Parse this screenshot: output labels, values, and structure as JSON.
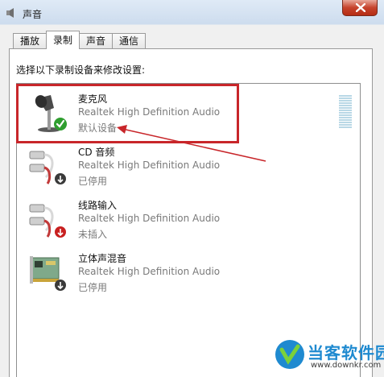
{
  "window": {
    "title": "声音"
  },
  "tabs": [
    {
      "label": "播放",
      "active": false
    },
    {
      "label": "录制",
      "active": true
    },
    {
      "label": "声音",
      "active": false
    },
    {
      "label": "通信",
      "active": false
    }
  ],
  "instruction": "选择以下录制设备来修改设置:",
  "devices": [
    {
      "name": "麦克风",
      "driver": "Realtek High Definition Audio",
      "status": "默认设备",
      "icon": "microphone-icon",
      "badge": "default-check"
    },
    {
      "name": "CD 音频",
      "driver": "Realtek High Definition Audio",
      "status": "已停用",
      "icon": "rca-jack-icon",
      "badge": "disabled-arrow"
    },
    {
      "name": "线路输入",
      "driver": "Realtek High Definition Audio",
      "status": "未插入",
      "icon": "rca-jack-icon",
      "badge": "unplugged-arrow"
    },
    {
      "name": "立体声混音",
      "driver": "Realtek High Definition Audio",
      "status": "已停用",
      "icon": "sound-card-icon",
      "badge": "disabled-arrow"
    }
  ],
  "watermark": {
    "text": "当客软件园",
    "url": "www.downkr.com"
  },
  "colors": {
    "highlight": "#c8262a",
    "watermark": "#1f8ad0",
    "check": "#2f9e2f"
  }
}
